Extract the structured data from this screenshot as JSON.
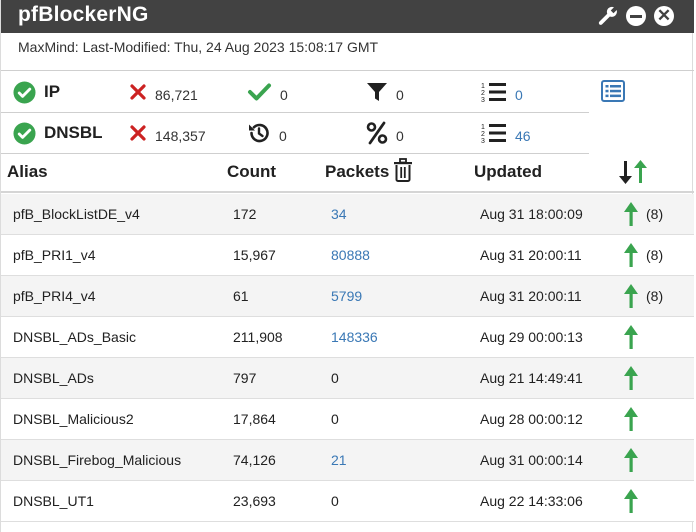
{
  "widget": {
    "title": "pfBlockerNG",
    "last_modified": "MaxMind: Last-Modified: Thu, 24 Aug 2023 15:08:17 GMT"
  },
  "stats": {
    "ip": {
      "label": "IP",
      "blocked": "86,721",
      "permitted": "0",
      "matched": "0",
      "count_link": "0"
    },
    "dnsbl": {
      "label": "DNSBL",
      "blocked": "148,357",
      "reset": "0",
      "percent": "0",
      "count_link": "46"
    }
  },
  "table": {
    "headers": {
      "alias": "Alias",
      "count": "Count",
      "packets": "Packets",
      "updated": "Updated"
    },
    "rows": [
      {
        "alias": "pfB_BlockListDE_v4",
        "count": "172",
        "packets": "34",
        "packets_link": true,
        "updated": "Aug 31 18:00:09",
        "rule_count": "(8)"
      },
      {
        "alias": "pfB_PRI1_v4",
        "count": "15,967",
        "packets": "80888",
        "packets_link": true,
        "updated": "Aug 31 20:00:11",
        "rule_count": "(8)"
      },
      {
        "alias": "pfB_PRI4_v4",
        "count": "61",
        "packets": "5799",
        "packets_link": true,
        "updated": "Aug 31 20:00:11",
        "rule_count": "(8)"
      },
      {
        "alias": "DNSBL_ADs_Basic",
        "count": "211,908",
        "packets": "148336",
        "packets_link": true,
        "updated": "Aug 29 00:00:13",
        "rule_count": ""
      },
      {
        "alias": "DNSBL_ADs",
        "count": "797",
        "packets": "0",
        "packets_link": false,
        "updated": "Aug 21 14:49:41",
        "rule_count": ""
      },
      {
        "alias": "DNSBL_Malicious2",
        "count": "17,864",
        "packets": "0",
        "packets_link": false,
        "updated": "Aug 28 00:00:12",
        "rule_count": ""
      },
      {
        "alias": "DNSBL_Firebog_Malicious",
        "count": "74,126",
        "packets": "21",
        "packets_link": true,
        "updated": "Aug 31 00:00:14",
        "rule_count": ""
      },
      {
        "alias": "DNSBL_UT1",
        "count": "23,693",
        "packets": "0",
        "packets_link": false,
        "updated": "Aug 22 14:33:06",
        "rule_count": ""
      }
    ]
  },
  "icons": {
    "titlebar": [
      "wrench-icon",
      "minus-circle-icon",
      "close-circle-icon"
    ],
    "stats_ip": [
      "check-circle-icon",
      "x-icon",
      "check-icon",
      "filter-icon",
      "list-ordered-icon",
      "list-alt-icon"
    ],
    "stats_dnsbl": [
      "check-circle-icon",
      "x-icon",
      "history-icon",
      "percent-icon",
      "list-ordered-icon"
    ],
    "table": [
      "trash-icon",
      "sort-up-down-icon",
      "arrow-up-icon"
    ]
  },
  "colors": {
    "titlebar": "#424242",
    "green": "#3aa44f",
    "red": "#cc2222",
    "link": "#3a78b5",
    "row_stripe": "#f4f4f4"
  }
}
